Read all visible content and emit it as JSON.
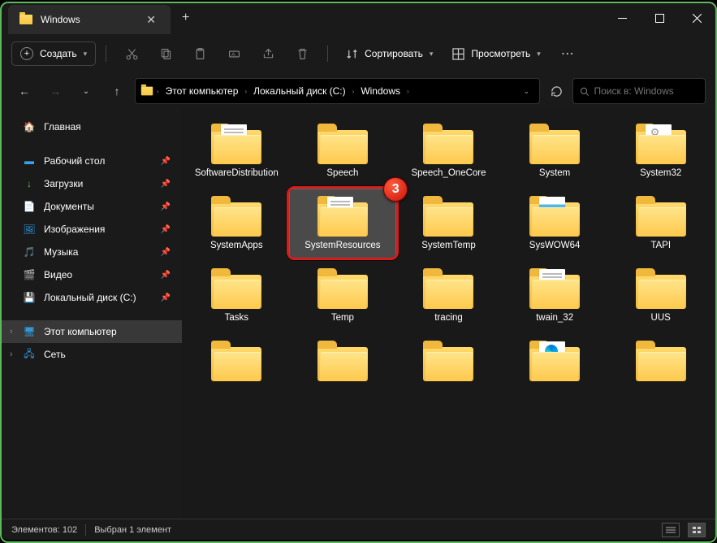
{
  "tab": {
    "title": "Windows"
  },
  "toolbar": {
    "create": "Создать",
    "sort": "Сортировать",
    "view": "Просмотреть"
  },
  "breadcrumb": {
    "seg1": "Этот компьютер",
    "seg2": "Локальный диск (C:)",
    "seg3": "Windows"
  },
  "search": {
    "placeholder": "Поиск в: Windows"
  },
  "sidebar": {
    "home": "Главная",
    "desktop": "Рабочий стол",
    "downloads": "Загрузки",
    "documents": "Документы",
    "pictures": "Изображения",
    "music": "Музыка",
    "videos": "Видео",
    "cdrive": "Локальный диск (С:)",
    "thispc": "Этот компьютер",
    "network": "Сеть"
  },
  "folders": [
    {
      "name": "SoftwareDistribution",
      "doc": "lines"
    },
    {
      "name": "Speech",
      "doc": ""
    },
    {
      "name": "Speech_OneCore",
      "doc": ""
    },
    {
      "name": "System",
      "doc": ""
    },
    {
      "name": "System32",
      "doc": "gear"
    },
    {
      "name": "SystemApps",
      "doc": ""
    },
    {
      "name": "SystemResources",
      "doc": "lines",
      "sel": true
    },
    {
      "name": "SystemTemp",
      "doc": ""
    },
    {
      "name": "SysWOW64",
      "doc": "blue"
    },
    {
      "name": "TAPI",
      "doc": ""
    },
    {
      "name": "Tasks",
      "doc": ""
    },
    {
      "name": "Temp",
      "doc": ""
    },
    {
      "name": "tracing",
      "doc": ""
    },
    {
      "name": "twain_32",
      "doc": "lines"
    },
    {
      "name": "UUS",
      "doc": ""
    },
    {
      "name": "",
      "doc": ""
    },
    {
      "name": "",
      "doc": ""
    },
    {
      "name": "",
      "doc": ""
    },
    {
      "name": "",
      "doc": "edge"
    },
    {
      "name": "",
      "doc": ""
    }
  ],
  "highlight": {
    "badge": "3"
  },
  "status": {
    "count": "Элементов: 102",
    "selected": "Выбран 1 элемент"
  }
}
